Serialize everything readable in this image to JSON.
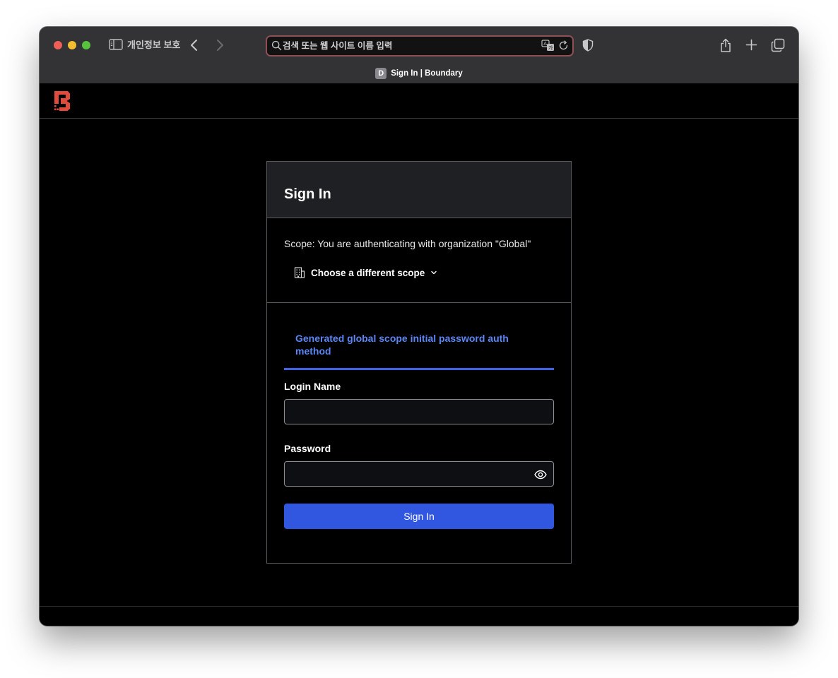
{
  "browser": {
    "privacy_label": "개인정보 보호",
    "address_placeholder": "검색 또는 웹 사이트 이름 입력",
    "tab_favicon_letter": "D",
    "tab_title": "Sign In | Boundary"
  },
  "app": {
    "logo": "boundary-logo",
    "brand_color": "#e34a3e"
  },
  "signin": {
    "title": "Sign In",
    "scope_text": "Scope: You are authenticating with organization \"Global\"",
    "scope_dropdown_label": "Choose a different scope",
    "auth_method_tab": "Generated global scope initial password auth method",
    "login_name_label": "Login Name",
    "login_name_value": "",
    "password_label": "Password",
    "password_value": "",
    "submit_label": "Sign In"
  },
  "colors": {
    "accent": "#3157e0",
    "tab_active": "#5c86f4",
    "address_ring": "#8e5054"
  }
}
